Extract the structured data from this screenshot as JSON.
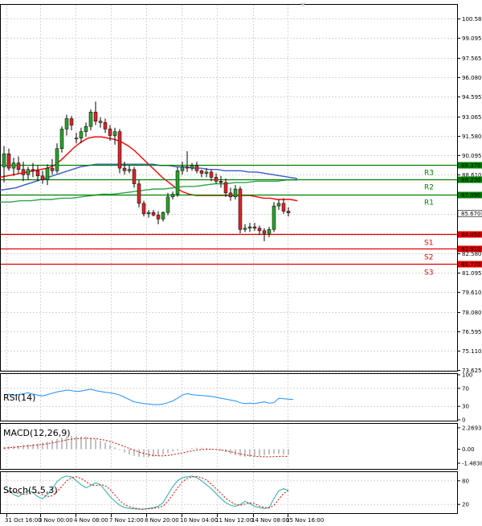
{
  "chart_data": {
    "type": "candlestick",
    "x_tick_labels": [
      "31 Oct 16:00",
      "3 Nov 00:00",
      "4 Nov 08:00",
      "7 Nov 12:00",
      "8 Nov 20:00",
      "10 Nov 04:00",
      "11 Nov 12:00",
      "14 Nov 08:00",
      "15 Nov 16:00"
    ],
    "price_panel": {
      "ylim": [
        73.625,
        101.5
      ],
      "y_ticks": [
        "100.580",
        "99.095",
        "97.565",
        "96.080",
        "94.595",
        "93.065",
        "91.580",
        "90.095",
        "88.610",
        "87.080",
        "85.595",
        "84.110",
        "82.580",
        "81.095",
        "79.610",
        "78.080",
        "76.595",
        "75.110",
        "73.625"
      ],
      "candles": [
        {
          "o": 89.2,
          "h": 90.8,
          "l": 88.0,
          "c": 90.2
        },
        {
          "o": 90.2,
          "h": 90.6,
          "l": 88.9,
          "c": 89.1
        },
        {
          "o": 89.1,
          "h": 89.9,
          "l": 88.5,
          "c": 89.5
        },
        {
          "o": 89.5,
          "h": 90.0,
          "l": 88.7,
          "c": 89.0
        },
        {
          "o": 89.0,
          "h": 89.6,
          "l": 88.1,
          "c": 88.6
        },
        {
          "o": 88.6,
          "h": 89.2,
          "l": 88.2,
          "c": 89.0
        },
        {
          "o": 89.0,
          "h": 89.5,
          "l": 88.4,
          "c": 88.9
        },
        {
          "o": 88.9,
          "h": 89.3,
          "l": 88.1,
          "c": 88.5
        },
        {
          "o": 88.5,
          "h": 88.9,
          "l": 87.9,
          "c": 88.2
        },
        {
          "o": 88.2,
          "h": 89.4,
          "l": 87.8,
          "c": 89.1
        },
        {
          "o": 89.1,
          "h": 89.8,
          "l": 88.6,
          "c": 88.9
        },
        {
          "o": 88.9,
          "h": 91.0,
          "l": 88.7,
          "c": 90.6
        },
        {
          "o": 90.6,
          "h": 92.3,
          "l": 90.3,
          "c": 92.1
        },
        {
          "o": 92.1,
          "h": 93.2,
          "l": 91.6,
          "c": 92.9
        },
        {
          "o": 92.9,
          "h": 93.1,
          "l": 92.0,
          "c": 92.4
        },
        {
          "o": 91.4,
          "h": 91.8,
          "l": 91.0,
          "c": 91.4
        },
        {
          "o": 91.4,
          "h": 92.2,
          "l": 91.0,
          "c": 91.9
        },
        {
          "o": 91.9,
          "h": 92.6,
          "l": 91.5,
          "c": 92.3
        },
        {
          "o": 92.3,
          "h": 93.6,
          "l": 92.0,
          "c": 93.4
        },
        {
          "o": 93.4,
          "h": 94.2,
          "l": 92.4,
          "c": 92.7
        },
        {
          "o": 92.7,
          "h": 93.0,
          "l": 92.2,
          "c": 92.6
        },
        {
          "o": 92.6,
          "h": 92.9,
          "l": 91.8,
          "c": 92.1
        },
        {
          "o": 92.1,
          "h": 92.4,
          "l": 91.2,
          "c": 91.6
        },
        {
          "o": 91.6,
          "h": 92.2,
          "l": 90.9,
          "c": 91.9
        },
        {
          "o": 91.9,
          "h": 92.1,
          "l": 88.7,
          "c": 89.1
        },
        {
          "o": 89.1,
          "h": 89.6,
          "l": 88.6,
          "c": 88.9
        },
        {
          "o": 88.9,
          "h": 89.3,
          "l": 88.7,
          "c": 89.0
        },
        {
          "o": 89.0,
          "h": 89.2,
          "l": 87.6,
          "c": 87.9
        },
        {
          "o": 87.9,
          "h": 88.2,
          "l": 86.1,
          "c": 86.4
        },
        {
          "o": 86.4,
          "h": 86.6,
          "l": 85.4,
          "c": 85.6
        },
        {
          "o": 85.6,
          "h": 85.9,
          "l": 85.3,
          "c": 85.7
        },
        {
          "o": 85.7,
          "h": 85.9,
          "l": 85.4,
          "c": 85.5
        },
        {
          "o": 85.5,
          "h": 85.8,
          "l": 84.8,
          "c": 85.2
        },
        {
          "o": 85.2,
          "h": 85.8,
          "l": 85.0,
          "c": 85.7
        },
        {
          "o": 85.7,
          "h": 87.2,
          "l": 85.5,
          "c": 86.9
        },
        {
          "o": 86.9,
          "h": 87.3,
          "l": 86.7,
          "c": 87.1
        },
        {
          "o": 87.1,
          "h": 89.2,
          "l": 86.9,
          "c": 88.9
        },
        {
          "o": 88.9,
          "h": 89.6,
          "l": 88.6,
          "c": 89.2
        },
        {
          "o": 89.2,
          "h": 90.4,
          "l": 88.8,
          "c": 89.1
        },
        {
          "o": 89.1,
          "h": 89.5,
          "l": 88.9,
          "c": 89.3
        },
        {
          "o": 89.3,
          "h": 89.6,
          "l": 88.7,
          "c": 88.9
        },
        {
          "o": 88.9,
          "h": 89.0,
          "l": 88.4,
          "c": 88.7
        },
        {
          "o": 88.7,
          "h": 89.1,
          "l": 88.4,
          "c": 88.8
        },
        {
          "o": 88.8,
          "h": 89.0,
          "l": 88.1,
          "c": 88.4
        },
        {
          "o": 88.4,
          "h": 88.7,
          "l": 87.9,
          "c": 88.1
        },
        {
          "o": 88.1,
          "h": 88.5,
          "l": 87.6,
          "c": 88.0
        },
        {
          "o": 88.0,
          "h": 88.3,
          "l": 86.9,
          "c": 87.2
        },
        {
          "o": 87.2,
          "h": 87.6,
          "l": 86.6,
          "c": 86.9
        },
        {
          "o": 86.9,
          "h": 87.8,
          "l": 86.7,
          "c": 87.5
        },
        {
          "o": 87.5,
          "h": 87.7,
          "l": 84.1,
          "c": 84.4
        },
        {
          "o": 84.4,
          "h": 84.8,
          "l": 84.2,
          "c": 84.5
        },
        {
          "o": 84.5,
          "h": 84.9,
          "l": 84.2,
          "c": 84.6
        },
        {
          "o": 84.6,
          "h": 84.9,
          "l": 84.3,
          "c": 84.5
        },
        {
          "o": 84.5,
          "h": 84.7,
          "l": 84.0,
          "c": 84.3
        },
        {
          "o": 84.3,
          "h": 84.5,
          "l": 83.5,
          "c": 84.1
        },
        {
          "o": 84.1,
          "h": 84.6,
          "l": 83.8,
          "c": 84.4
        },
        {
          "o": 84.4,
          "h": 86.5,
          "l": 84.2,
          "c": 86.2
        },
        {
          "o": 86.2,
          "h": 86.7,
          "l": 85.9,
          "c": 86.4
        },
        {
          "o": 86.4,
          "h": 86.8,
          "l": 85.6,
          "c": 85.8
        },
        {
          "o": 85.8,
          "h": 86.1,
          "l": 85.4,
          "c": 85.67
        }
      ],
      "series": [
        {
          "color": "#ff0000",
          "values": [
            88.4,
            88.5,
            88.6,
            88.7,
            88.8,
            88.9,
            89.0,
            89.1,
            89.3,
            89.7,
            90.2,
            90.7,
            91.1,
            91.4,
            91.5,
            91.5,
            91.4,
            91.3,
            91.1,
            90.8,
            90.4,
            89.9,
            89.4,
            88.9,
            88.4,
            88.0,
            87.6,
            87.3,
            87.1,
            87.0,
            87.0,
            87.0,
            87.0,
            87.0,
            87.0,
            87.0,
            87.0,
            87.0,
            86.9,
            86.8,
            86.8,
            86.7,
            86.7,
            86.7,
            86.6
          ]
        },
        {
          "color": "#3a5bc7",
          "values": [
            87.4,
            87.5,
            87.6,
            87.8,
            88.0,
            88.2,
            88.4,
            88.6,
            88.8,
            89.0,
            89.2,
            89.3,
            89.4,
            89.4,
            89.4,
            89.4,
            89.4,
            89.4,
            89.4,
            89.4,
            89.3,
            89.3,
            89.2,
            89.2,
            89.1,
            89.1,
            89.0,
            89.0,
            88.9,
            88.9,
            88.9,
            88.8,
            88.8,
            88.7,
            88.6,
            88.5,
            88.4,
            88.3
          ]
        },
        {
          "color": "#2aa84a",
          "values": [
            86.5,
            86.5,
            86.6,
            86.6,
            86.7,
            86.7,
            86.8,
            86.8,
            86.9,
            87.0,
            87.1,
            87.1,
            87.2,
            87.3,
            87.4,
            87.5,
            87.5,
            87.6,
            87.7,
            87.7,
            87.8,
            87.9,
            87.9,
            88.0,
            88.0,
            88.1,
            88.1,
            88.1,
            88.2,
            88.2
          ]
        }
      ],
      "levels": [
        {
          "label": "R3",
          "value": 89.37,
          "price": "89.370",
          "color": "#008000"
        },
        {
          "label": "R2",
          "value": 88.23,
          "price": "88.230",
          "color": "#008000"
        },
        {
          "label": "R1",
          "value": 87.09,
          "price": "87.090",
          "color": "#008000"
        },
        {
          "label": "S1",
          "value": 84.05,
          "price": "84.050",
          "color": "#e00000"
        },
        {
          "label": "S2",
          "value": 82.91,
          "price": "82.910",
          "color": "#e00000"
        },
        {
          "label": "S3",
          "value": 81.77,
          "price": "81.770",
          "color": "#e00000"
        }
      ],
      "current_price": {
        "value": 85.67,
        "label": "85.670"
      }
    },
    "rsi_panel": {
      "title": "RSI(14)",
      "ylim": [
        0,
        100
      ],
      "y_ticks": [
        "100",
        "70",
        "30",
        "0"
      ],
      "levels": [
        70,
        30
      ],
      "values": [
        55,
        57,
        54,
        56,
        58,
        60,
        57,
        55,
        53,
        56,
        59,
        62,
        64,
        66,
        65,
        63,
        64,
        66,
        68,
        65,
        63,
        61,
        60,
        58,
        55,
        50,
        45,
        40,
        38,
        36,
        35,
        34,
        34,
        35,
        38,
        42,
        48,
        55,
        58,
        56,
        55,
        54,
        53,
        52,
        50,
        48,
        46,
        44,
        42,
        38,
        36,
        37,
        36,
        38,
        40,
        37,
        38,
        48,
        47,
        46,
        45
      ]
    },
    "macd_panel": {
      "title": "MACD(12,26,9)",
      "y_ticks": [
        "2.2693",
        "0.00",
        "-1.4838"
      ],
      "ylim": [
        -2.0,
        2.6
      ],
      "histogram": [
        0.25,
        0.3,
        0.35,
        0.4,
        0.45,
        0.5,
        0.55,
        0.6,
        0.7,
        0.8,
        0.95,
        1.1,
        1.25,
        1.35,
        1.4,
        1.4,
        1.35,
        1.3,
        1.2,
        1.05,
        0.9,
        0.7,
        0.45,
        0.2,
        -0.1,
        -0.35,
        -0.55,
        -0.7,
        -0.8,
        -0.85,
        -0.85,
        -0.8,
        -0.7,
        -0.55,
        -0.4,
        -0.25,
        -0.15,
        -0.05,
        0.05,
        0.1,
        0.15,
        0.15,
        0.1,
        0.05,
        -0.05,
        -0.15,
        -0.3,
        -0.5,
        -0.65,
        -0.75,
        -0.8,
        -0.8,
        -0.75,
        -0.7,
        -0.65,
        -0.55,
        -0.5,
        -0.5,
        -0.55,
        -0.6
      ],
      "signal": [
        0.1,
        0.15,
        0.2,
        0.25,
        0.3,
        0.35,
        0.4,
        0.45,
        0.5,
        0.58,
        0.66,
        0.76,
        0.88,
        0.98,
        1.06,
        1.12,
        1.15,
        1.16,
        1.15,
        1.12,
        1.05,
        0.95,
        0.82,
        0.66,
        0.48,
        0.28,
        0.08,
        -0.12,
        -0.3,
        -0.45,
        -0.58,
        -0.66,
        -0.7,
        -0.7,
        -0.66,
        -0.58,
        -0.48,
        -0.38,
        -0.28,
        -0.18,
        -0.1,
        -0.04,
        0.0,
        0.0,
        -0.03,
        -0.08,
        -0.16,
        -0.26,
        -0.38,
        -0.5,
        -0.6,
        -0.68,
        -0.74,
        -0.78,
        -0.8,
        -0.8,
        -0.78,
        -0.76,
        -0.75,
        -0.76
      ]
    },
    "stoch_panel": {
      "title": "Stoch(5,5,3)",
      "ylim": [
        0,
        100
      ],
      "y_ticks": [
        "80",
        "20"
      ],
      "levels": [
        80,
        20
      ],
      "k": [
        60,
        55,
        45,
        40,
        48,
        55,
        50,
        40,
        35,
        45,
        60,
        78,
        88,
        92,
        90,
        80,
        70,
        62,
        68,
        75,
        70,
        55,
        40,
        28,
        18,
        12,
        10,
        9,
        8,
        8,
        10,
        12,
        15,
        25,
        45,
        65,
        80,
        88,
        90,
        92,
        88,
        80,
        70,
        60,
        48,
        35,
        25,
        18,
        15,
        20,
        28,
        22,
        15,
        12,
        10,
        12,
        35,
        55,
        60,
        55
      ],
      "d": [
        50,
        52,
        52,
        48,
        46,
        47,
        51,
        50,
        45,
        40,
        42,
        52,
        66,
        80,
        88,
        90,
        86,
        78,
        70,
        68,
        70,
        68,
        58,
        44,
        30,
        20,
        14,
        11,
        9,
        8,
        9,
        10,
        12,
        16,
        28,
        45,
        62,
        78,
        86,
        90,
        91,
        88,
        82,
        72,
        60,
        48,
        36,
        27,
        20,
        18,
        21,
        24,
        22,
        16,
        12,
        11,
        18,
        33,
        48,
        55
      ]
    }
  }
}
